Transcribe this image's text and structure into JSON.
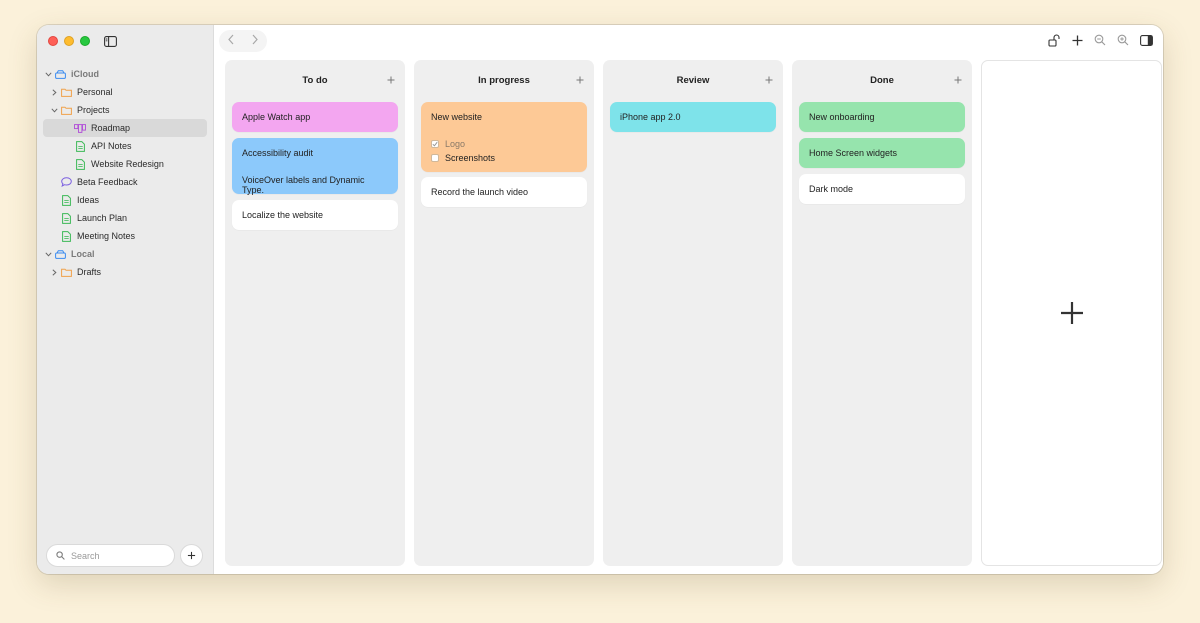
{
  "window": {
    "traffic_lights": {
      "close": "#fe5f57",
      "minimize": "#febc2e",
      "zoom": "#28c840"
    }
  },
  "sidebar": {
    "toggle_icon": "sidebar-toggle-icon",
    "tree": [
      {
        "label": "iCloud",
        "icon": "cloud-drive-icon",
        "level": 0,
        "expanded": true,
        "section": true
      },
      {
        "label": "Personal",
        "icon": "folder-icon",
        "level": 1,
        "expanded": false
      },
      {
        "label": "Projects",
        "icon": "folder-icon",
        "level": 1,
        "expanded": true
      },
      {
        "label": "Roadmap",
        "icon": "board-icon",
        "level": 2,
        "selected": true
      },
      {
        "label": "API Notes",
        "icon": "document-icon",
        "level": 2
      },
      {
        "label": "Website Redesign",
        "icon": "document-icon",
        "level": 2
      },
      {
        "label": "Beta Feedback",
        "icon": "chat-bubble-icon",
        "level": 1
      },
      {
        "label": "Ideas",
        "icon": "document-icon",
        "level": 1
      },
      {
        "label": "Launch Plan",
        "icon": "document-icon",
        "level": 1
      },
      {
        "label": "Meeting Notes",
        "icon": "document-icon",
        "level": 1
      },
      {
        "label": "Local",
        "icon": "drive-icon",
        "level": 0,
        "expanded": true,
        "section": true
      },
      {
        "label": "Drafts",
        "icon": "folder-icon",
        "level": 1,
        "expanded": false
      }
    ],
    "search": {
      "placeholder": "Search",
      "value": ""
    },
    "add_button_icon": "plus-icon"
  },
  "toolbar": {
    "back_icon": "chevron-left-icon",
    "forward_icon": "chevron-right-icon",
    "right_icons": [
      "lock-open-icon",
      "plus-icon",
      "zoom-out-icon",
      "zoom-in-icon",
      "inspector-icon"
    ]
  },
  "board": {
    "columns": [
      {
        "title": "To do",
        "cards": [
          {
            "title": "Apple Watch app",
            "color": "#f3a6f0"
          },
          {
            "title": "Accessibility audit",
            "subtitle": "VoiceOver labels and Dynamic Type.",
            "color": "#8cc9fb"
          },
          {
            "title": "Localize the website",
            "color": "#ffffff"
          }
        ]
      },
      {
        "title": "In progress",
        "cards": [
          {
            "title": "New website",
            "color": "#fdc996",
            "checklist": [
              {
                "label": "Logo",
                "checked": true
              },
              {
                "label": "Screenshots",
                "checked": false
              }
            ]
          },
          {
            "title": "Record the launch video",
            "color": "#ffffff"
          }
        ]
      },
      {
        "title": "Review",
        "cards": [
          {
            "title": "iPhone app 2.0",
            "color": "#7ee3ea"
          }
        ]
      },
      {
        "title": "Done",
        "cards": [
          {
            "title": "New onboarding",
            "color": "#96e4ad"
          },
          {
            "title": "Home Screen widgets",
            "color": "#96e4ad"
          },
          {
            "title": "Dark mode",
            "color": "#ffffff"
          }
        ]
      }
    ],
    "add_column_icon": "plus-icon"
  }
}
